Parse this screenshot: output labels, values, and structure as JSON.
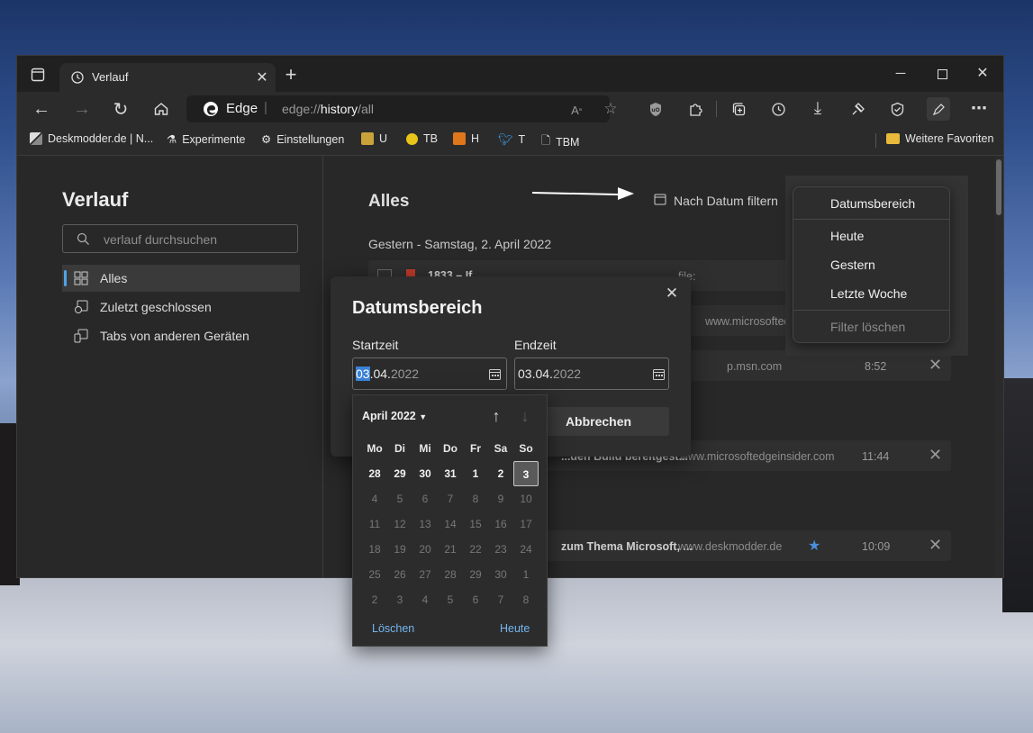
{
  "browser": {
    "tab_title": "Verlauf",
    "address_brand": "Edge",
    "address_prefix": "edge://",
    "address_bold": "history",
    "address_suffix": "/all"
  },
  "favorites": {
    "items": [
      "Deskmodder.de | N...",
      "Experimente",
      "Einstellungen",
      "U",
      "TB",
      "H",
      "T",
      "TBM"
    ],
    "more": "Weitere Favoriten"
  },
  "sidebar": {
    "title": "Verlauf",
    "search_placeholder": "verlauf durchsuchen",
    "items": [
      "Alles",
      "Zuletzt geschlossen",
      "Tabs von anderen Geräten"
    ]
  },
  "main": {
    "title": "Alles",
    "filter_label": "Nach Datum filtern",
    "day_label": "Gestern - Samstag, 2. April 2022",
    "rows": [
      {
        "title": "1833 – If...",
        "url": "file:",
        "time": ""
      },
      {
        "title": "",
        "url": "www.microsoftedgeinsid",
        "time": ""
      },
      {
        "title": "",
        "url": "p.msn.com",
        "time": "8:52"
      },
      {
        "title": "...den Build bereitgest...",
        "url": "www.microsoftedgeinsider.com",
        "time": "11:44"
      },
      {
        "title": "zum Thema Microsoft, ...",
        "url": "www.deskmodder.de",
        "time": "10:09"
      }
    ]
  },
  "filter_menu": {
    "items": [
      "Datumsbereich",
      "Heute",
      "Gestern",
      "Letzte Woche",
      "Filter löschen"
    ]
  },
  "dialog": {
    "title": "Datumsbereich",
    "start_label": "Startzeit",
    "start_day": "03",
    "start_month": ".04.",
    "start_year": "2022",
    "end_label": "Endzeit",
    "end_day": "03",
    "end_month": ".04.",
    "end_year": "2022",
    "cancel": "Abbrechen"
  },
  "calendar": {
    "month": "April 2022",
    "weekdays": [
      "Mo",
      "Di",
      "Mi",
      "Do",
      "Fr",
      "Sa",
      "So"
    ],
    "weeks": [
      [
        "28",
        "29",
        "30",
        "31",
        "1",
        "2",
        "3"
      ],
      [
        "4",
        "5",
        "6",
        "7",
        "8",
        "9",
        "10"
      ],
      [
        "11",
        "12",
        "13",
        "14",
        "15",
        "16",
        "17"
      ],
      [
        "18",
        "19",
        "20",
        "21",
        "22",
        "23",
        "24"
      ],
      [
        "25",
        "26",
        "27",
        "28",
        "29",
        "30",
        "1"
      ],
      [
        "2",
        "3",
        "4",
        "5",
        "6",
        "7",
        "8"
      ]
    ],
    "clear": "Löschen",
    "today": "Heute"
  }
}
